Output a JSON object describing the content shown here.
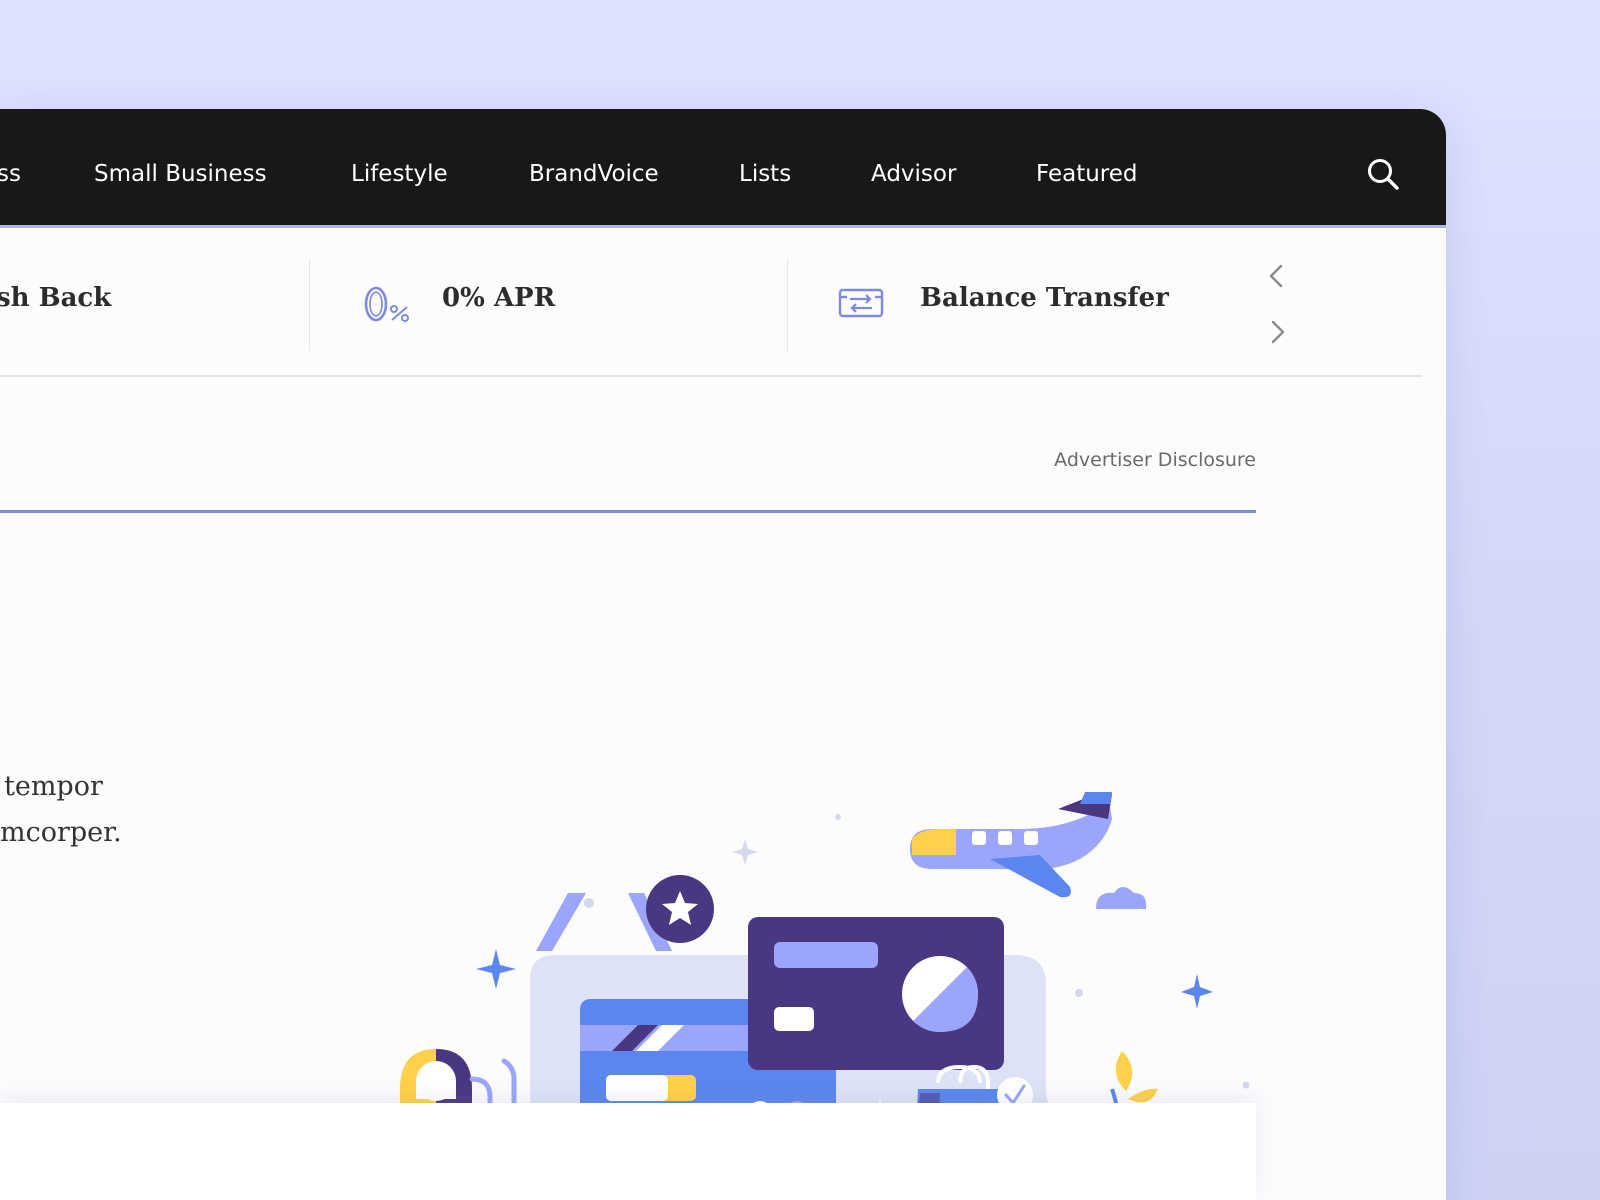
{
  "nav": {
    "items": [
      {
        "label": "ss"
      },
      {
        "label": "Small Business"
      },
      {
        "label": "Lifestyle"
      },
      {
        "label": "BrandVoice"
      },
      {
        "label": "Lists"
      },
      {
        "label": "Advisor"
      },
      {
        "label": "Featured"
      }
    ],
    "search_icon": "search-icon"
  },
  "categories": [
    {
      "label": "sh Back"
    },
    {
      "label": "0% APR",
      "icon": "zero-percent-icon"
    },
    {
      "label": "Balance Transfer",
      "icon": "balance-transfer-icon"
    }
  ],
  "carousel": {
    "prev_icon": "chevron-up-left-icon",
    "next_icon": "chevron-right-icon"
  },
  "disclosure": {
    "label": "Advertiser Disclosure"
  },
  "body": {
    "line1": "tempor",
    "line2": "mcorper."
  },
  "colors": {
    "nav_bg": "#181818",
    "accent": "#7c8ae0",
    "illus_blue": "#5b86ef",
    "illus_purple": "#4a3782",
    "illus_lavender": "#9aa5fb",
    "illus_yellow": "#ffd04a"
  }
}
